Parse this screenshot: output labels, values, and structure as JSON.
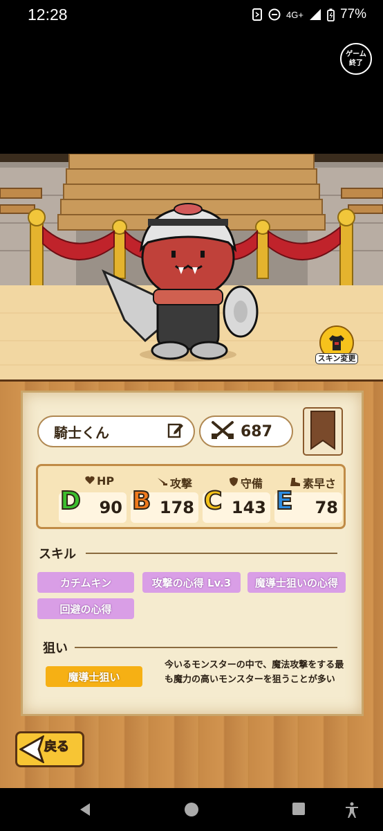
{
  "status_bar": {
    "time": "12:28",
    "network": "4G+",
    "battery": "77%"
  },
  "game": {
    "end_button_label": "ゲーム終了",
    "skin_change_label": "スキン変更"
  },
  "character": {
    "name": "騎士くん",
    "power": "687"
  },
  "stats": [
    {
      "label": "HP",
      "icon": "heart-icon",
      "rank": "D",
      "value": "90",
      "rank_color": "#3cbf2e"
    },
    {
      "label": "攻撃",
      "icon": "sword-icon",
      "rank": "B",
      "value": "178",
      "rank_color": "#f07a1c"
    },
    {
      "label": "守備",
      "icon": "shield-icon",
      "rank": "C",
      "value": "143",
      "rank_color": "#f5c31a"
    },
    {
      "label": "素早さ",
      "icon": "boot-icon",
      "rank": "E",
      "value": "78",
      "rank_color": "#2c8be0"
    }
  ],
  "skills": {
    "title": "スキル",
    "items": [
      "カチムキン",
      "攻撃の心得 Lv.3",
      "魔導士狙いの心得",
      "回避の心得"
    ]
  },
  "target": {
    "title": "狙い",
    "chip": "魔導士狙い",
    "description": "今いるモンスターの中で、魔法攻撃をする最も魔力の高いモンスターを狙うことが多い"
  },
  "back_label": "戻る",
  "colors": {
    "skill_chip": "#d99ee6",
    "target_chip": "#f6b014",
    "wood": "#c88a47",
    "parchment": "#f5ebcf"
  }
}
